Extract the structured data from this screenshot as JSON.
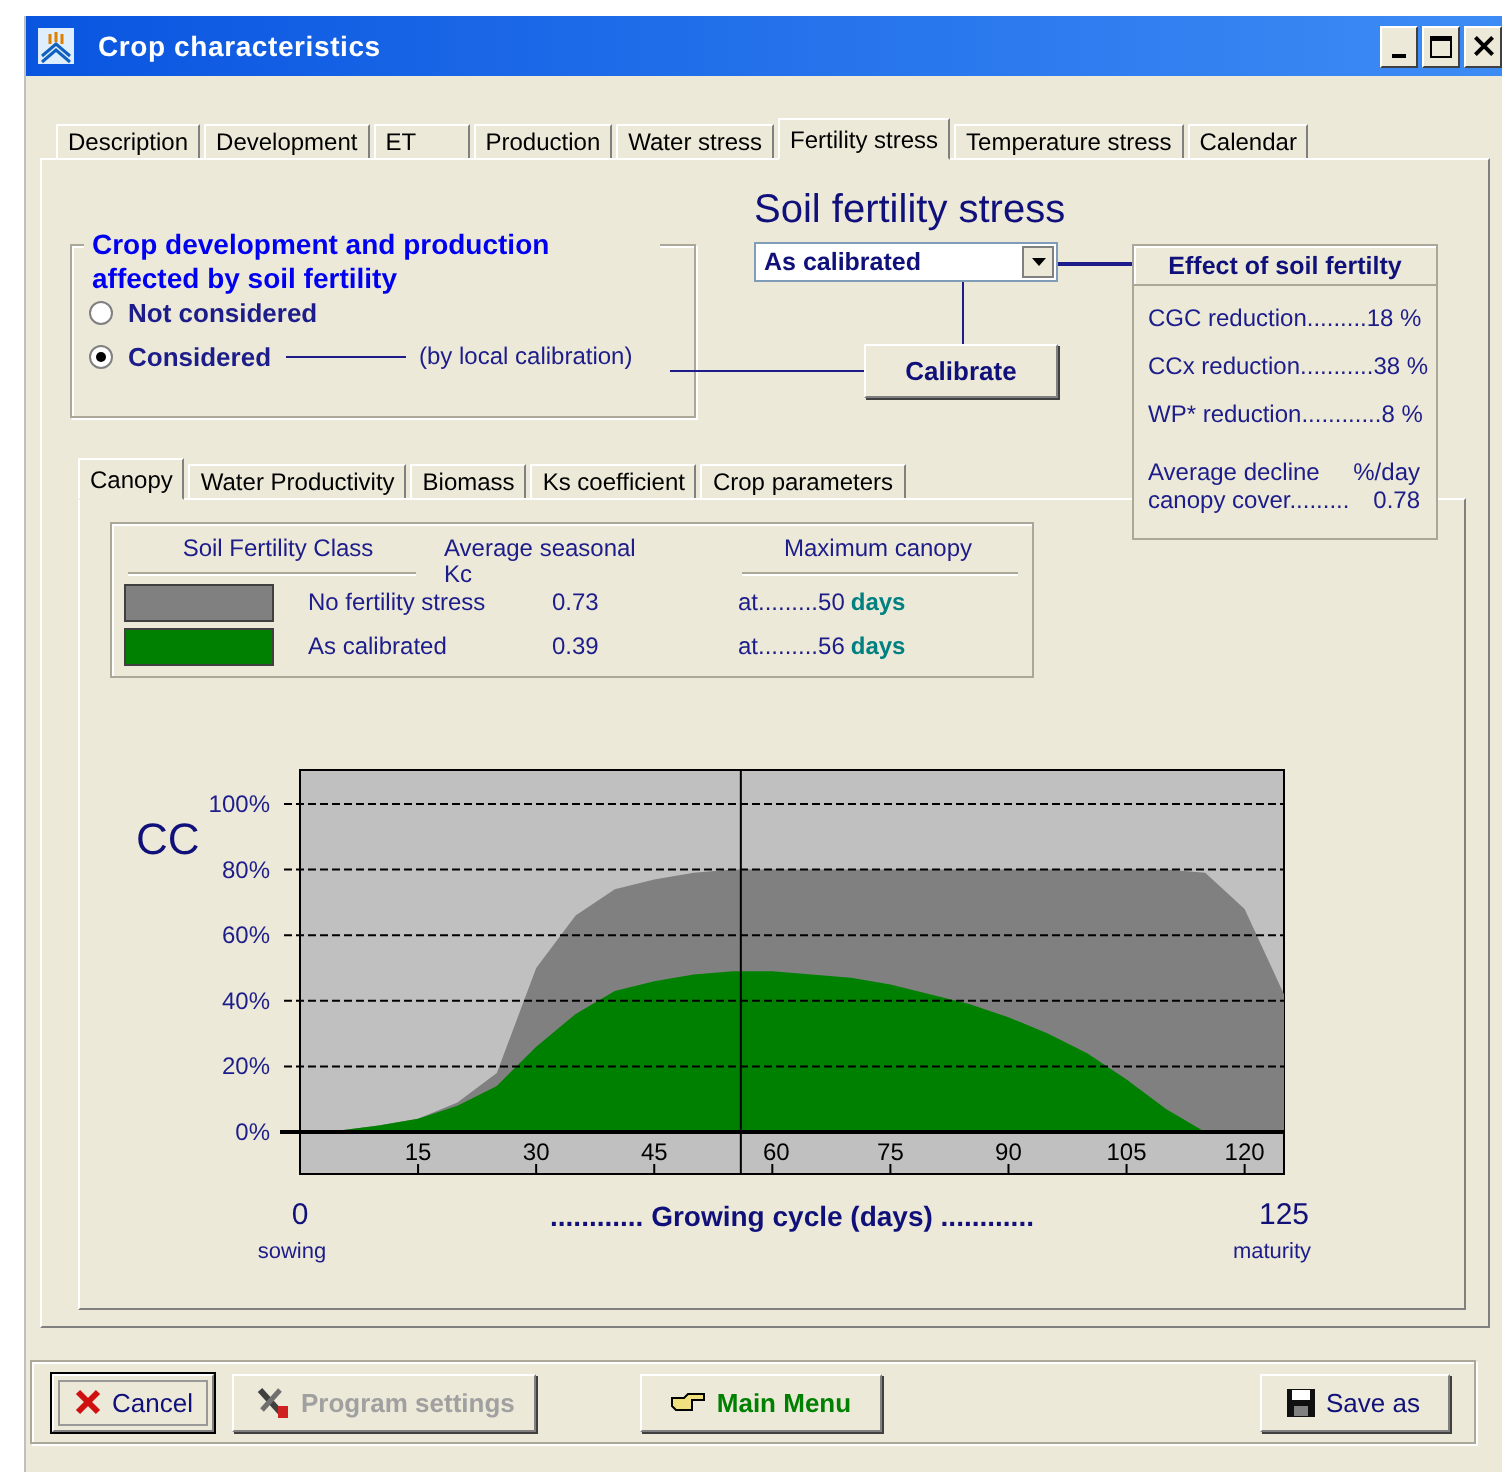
{
  "window": {
    "title": "Crop characteristics"
  },
  "tabs": [
    {
      "label": "Description",
      "selected": false
    },
    {
      "label": "Development",
      "selected": false
    },
    {
      "label": "ET",
      "selected": false
    },
    {
      "label": "Production",
      "selected": false
    },
    {
      "label": "Water stress",
      "selected": false
    },
    {
      "label": "Fertility stress",
      "selected": true
    },
    {
      "label": "Temperature stress",
      "selected": false
    },
    {
      "label": "Calendar",
      "selected": false
    }
  ],
  "fertility": {
    "heading": "Soil fertility stress",
    "dropdown": {
      "value": "As calibrated"
    },
    "calibrate_button": "Calibrate"
  },
  "group": {
    "title": "Crop development and production affected by soil fertility",
    "note": "(by local calibration)",
    "options": [
      {
        "label": "Not considered",
        "selected": false
      },
      {
        "label": "Considered",
        "selected": true
      }
    ]
  },
  "effect": {
    "title": "Effect of soil fertilty",
    "rows": [
      {
        "label": "CGC reduction.........",
        "value": "18 %"
      },
      {
        "label": "CCx reduction...........",
        "value": "38 %"
      },
      {
        "label": "WP* reduction............",
        "value": "8 %"
      }
    ],
    "decline": {
      "label": "Average decline",
      "unit": "%/day",
      "label2": "canopy cover.........",
      "value": "0.78"
    }
  },
  "subtabs": [
    {
      "label": "Canopy",
      "selected": true
    },
    {
      "label": "Water Productivity",
      "selected": false
    },
    {
      "label": "Biomass",
      "selected": false
    },
    {
      "label": "Ks coefficient",
      "selected": false
    },
    {
      "label": "Crop parameters",
      "selected": false
    }
  ],
  "legend": {
    "columns": [
      "Soil Fertility Class",
      "Average seasonal Kc",
      "Maximum canopy"
    ],
    "rows": [
      {
        "kc": "0.73",
        "at": "at.........",
        "days": "50",
        "unit": "days"
      },
      {
        "kc": "0.39",
        "at": "at.........",
        "days": "56",
        "unit": "days"
      }
    ]
  },
  "chart": {
    "x_start": "0",
    "x_start_note": "sowing",
    "x_end": "125",
    "x_end_note": "maturity",
    "chart_data": {
      "type": "area",
      "xlabel": "............  Growing cycle (days) ............",
      "ylabel": "CC",
      "x": [
        0,
        5,
        10,
        15,
        20,
        25,
        30,
        35,
        40,
        45,
        50,
        55,
        60,
        65,
        70,
        75,
        80,
        85,
        90,
        95,
        100,
        105,
        110,
        115,
        120,
        125
      ],
      "series": [
        {
          "name": "No fertility stress",
          "color": "#808080",
          "values": [
            0,
            0.5,
            2,
            4,
            9,
            18,
            50,
            66,
            74,
            77,
            79,
            80,
            80,
            80,
            80,
            80,
            80,
            80,
            80,
            80,
            80,
            80,
            80,
            79,
            68,
            42
          ]
        },
        {
          "name": "As calibrated",
          "color": "#008000",
          "values": [
            0,
            0.5,
            2,
            4,
            8,
            14,
            26,
            36,
            43,
            46,
            48,
            49,
            49,
            48,
            47,
            45,
            42,
            39,
            35,
            30,
            24,
            16,
            7,
            0,
            0,
            0
          ]
        }
      ],
      "xlim": [
        0,
        125
      ],
      "ylim": [
        0,
        100
      ],
      "xticks": [
        15,
        30,
        45,
        60,
        75,
        90,
        105,
        120
      ],
      "yticks": [
        {
          "value": 0,
          "label": "0%"
        },
        {
          "value": 20,
          "label": "20%"
        },
        {
          "value": 40,
          "label": "40%"
        },
        {
          "value": 60,
          "label": "60%"
        },
        {
          "value": 80,
          "label": "80%"
        },
        {
          "value": 100,
          "label": "100%"
        }
      ],
      "grid": true,
      "ref_lines": [
        {
          "axis": "x",
          "value": 56
        }
      ]
    }
  },
  "buttons": [
    {
      "label": "Cancel",
      "kind": "cancel",
      "disabled": false,
      "focused": true
    },
    {
      "label": "Program settings",
      "kind": "settings",
      "disabled": true,
      "focused": false
    },
    {
      "label": "Main Menu",
      "kind": "menu",
      "disabled": false,
      "focused": false
    },
    {
      "label": "Save as",
      "kind": "save",
      "disabled": false,
      "focused": false
    }
  ]
}
